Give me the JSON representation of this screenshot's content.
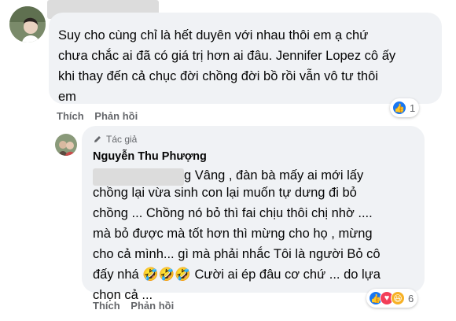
{
  "comment1": {
    "text": "Suy cho cùng chỉ là hết duyên với nhau thôi em ạ chứ\nchưa chắc ai đã có giá trị hơn ai đâu. Jennifer Lopez cô ấy\nkhi thay đến cả chục đời chồng đời bồ rồi vẫn vô tư thôi\nem",
    "actions": {
      "like": "Thích",
      "reply": "Phản hồi"
    },
    "reactions": {
      "count": "1",
      "icons": [
        "like-icon"
      ]
    }
  },
  "reply1": {
    "author_badge": "Tác giả",
    "author_name": "Nguyễn Thu Phượng",
    "text_first": "g Vâng , đàn bà mấy ai mới lấy",
    "text_rest": "chồng lại vừa sinh con lại muốn tự dưng đi bỏ\nchồng ... Chồng nó bỏ thì fai chịu thôi chị nhờ ....\nmà bỏ được mà tốt hơn thì mừng cho họ , mừng\ncho cả mình... gì mà phải nhắc Tôi là người Bỏ cô\nđấy nhá 🤣🤣🤣 Cười ai ép đâu cơ chứ ... do lựa\nchọn cả ...",
    "actions": {
      "like": "Thích",
      "reply": "Phản hồi"
    },
    "reactions": {
      "count": "6",
      "icons": [
        "like-icon",
        "love-icon",
        "haha-icon"
      ]
    }
  },
  "colors": {
    "like": "#1877f2",
    "love": "#f33e58",
    "haha": "#f7b125",
    "bubble": "#f0f2f5",
    "muted": "#65676b"
  }
}
